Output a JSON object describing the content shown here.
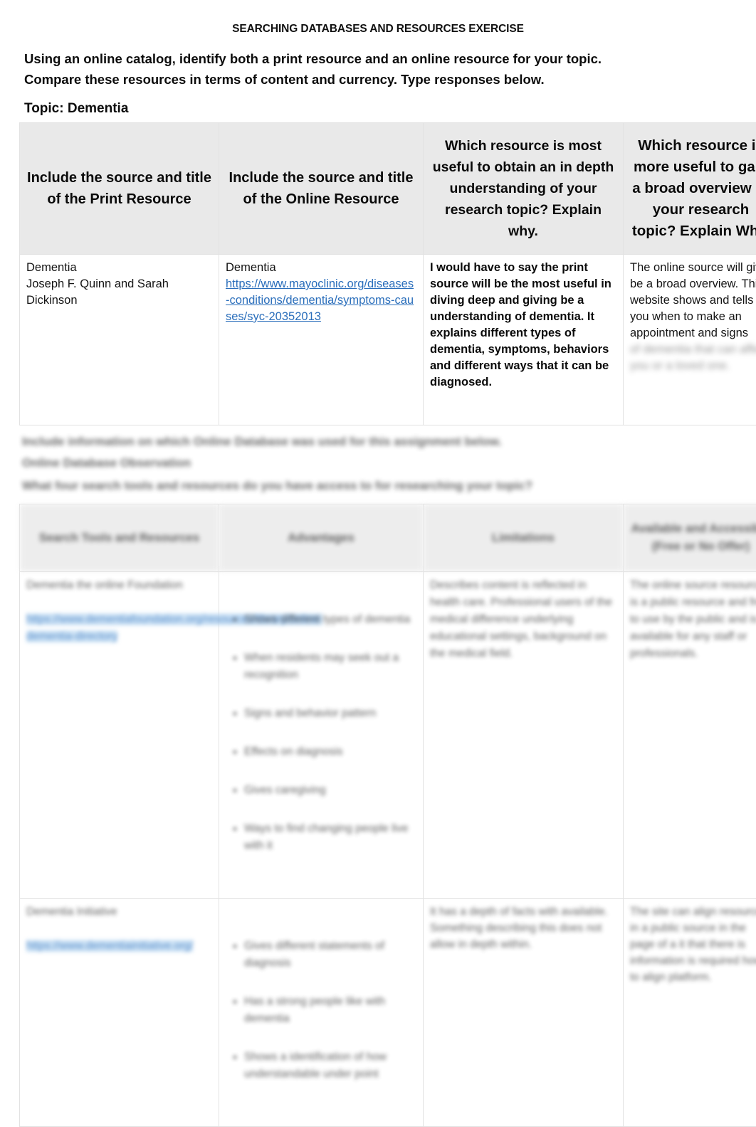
{
  "document": {
    "header_title": "SEARCHING DATABASES AND RESOURCES EXERCISE",
    "instructions_line1": "Using an online catalog, identify both a print resource and an online resource for your topic.",
    "instructions_line2": "Compare these resources in terms of content and currency.  Type responses below.",
    "topic_label": "Topic:",
    "topic_value": "Dementia"
  },
  "compare_table": {
    "headers": {
      "print_resource": "Include the source and title of the Print Resource",
      "online_resource": "Include the source and title of the Online Resource",
      "in_depth": "Which resource is most useful to obtain an in depth understanding of your research topic? Explain why.",
      "broad_overview": "Which resource is more useful to gain a broad overview of your research topic? Explain Why."
    },
    "row": {
      "print_resource_title": "Dementia",
      "print_resource_authors": "Joseph F. Quinn and Sarah Dickinson",
      "online_resource_title": "Dementia",
      "online_resource_url": "https://www.mayoclinic.org/diseases-conditions/dementia/symptoms-causes/syc-20352013",
      "in_depth_answer": "I would have to say the print source will be the most useful in diving deep and giving be a understanding of dementia. It explains different types of dementia, symptoms, behaviors and different ways that it can be diagnosed.",
      "broad_overview_answer": "The online source will give be a broad overview. This website shows and tells you when to make an appointment and signs",
      "broad_overview_answer_obscured": "of dementia that can affect you or a loved one."
    }
  },
  "prompts": {
    "database_prompt": "Include information on which Online Database was used for this assignment below.\nOnline Database Observation",
    "search_tools_prompt": "What four search tools and resources do you have access to for researching your topic?"
  },
  "tools_table": {
    "headers": {
      "search_tools": "Search Tools and Resources",
      "advantages": "Advantages",
      "limitations": "Limitations",
      "availability": "Available and Accessible (Free or No Offer)"
    },
    "rows": [
      {
        "search_tools_label": "Dementia the online Foundation",
        "search_tools_link": "https://www.dementiafoundation.org/resources/library/online-dementia-directory",
        "advantages": [
          "Shows different types of dementia",
          "When residents may seek out a recognition",
          "Signs and behavior pattern",
          "Effects on diagnosis",
          "Gives caregiving",
          "Ways to find changing people live with it"
        ],
        "limitations": "Describes content is reflected in health care. Professional users of the medical difference underlying educational settings, background on the medical field.",
        "availability": "The online source resource is a public resource and free to use by the public and is available for any staff or professionals."
      },
      {
        "search_tools_label": "Dementia Initiative",
        "search_tools_link": "https://www.dementiainitiative.org/",
        "advantages": [
          "Gives different statements of diagnosis",
          "Has a strong people like with dementia",
          "Shows a identification of how understandable under point"
        ],
        "limitations": "It has a depth of facts with available. Something describing this does not allow in depth within.",
        "availability": "The site can align resource in a public source in the page of a it that there is information is required how to align platform."
      }
    ]
  }
}
